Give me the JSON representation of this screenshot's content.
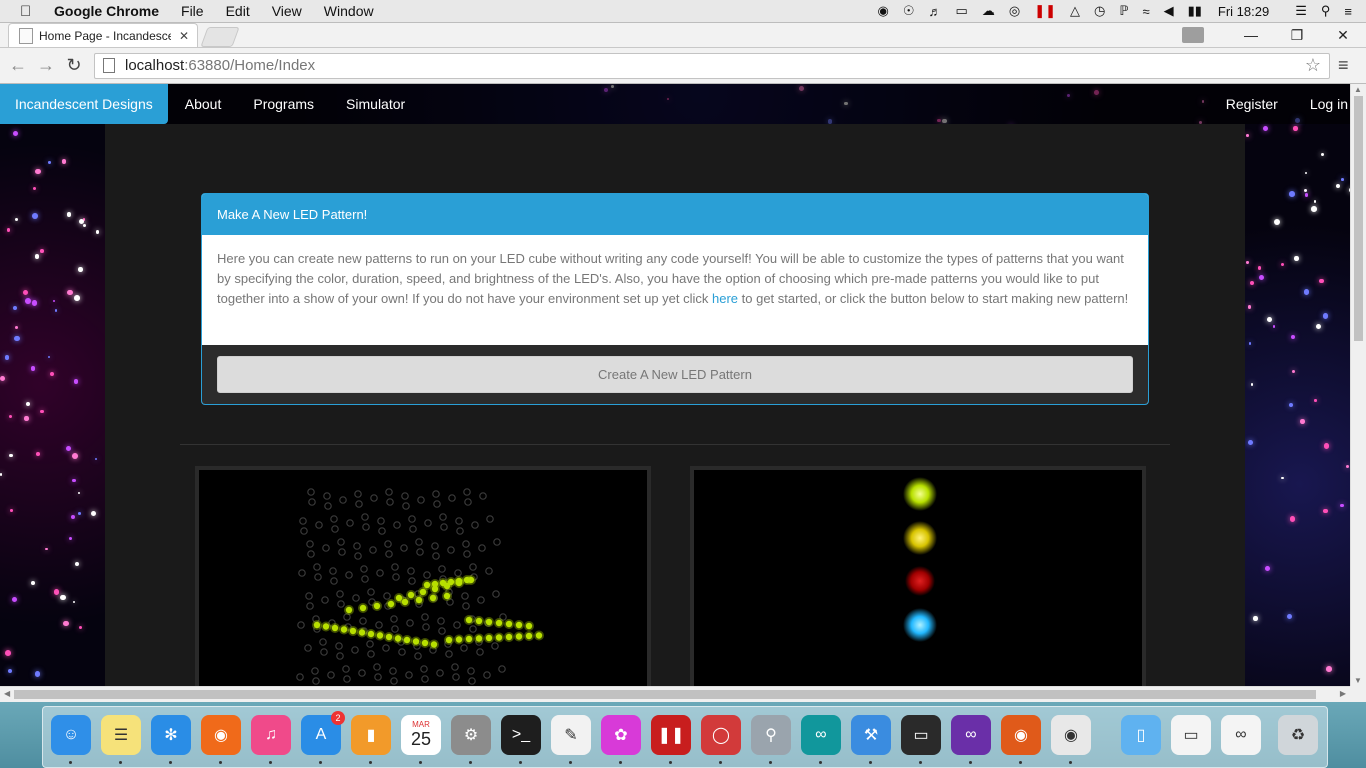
{
  "menubar": {
    "app": "Google Chrome",
    "items": [
      "File",
      "Edit",
      "View",
      "Window"
    ],
    "clock": "Fri 18:29"
  },
  "tab": {
    "title": "Home Page - Incandescen"
  },
  "address": {
    "host": "localhost",
    "path": ":63880/Home/Index"
  },
  "site": {
    "brand": "Incandescent Designs",
    "nav": [
      "About",
      "Programs",
      "Simulator"
    ],
    "nav_right": [
      "Register",
      "Log in"
    ]
  },
  "panel": {
    "heading": "Make A New LED Pattern!",
    "body_before": "Here you can create new patterns to run on your LED cube without writing any code yourself! You will be able to customize the types of patterns that you want by specifying the color, duration, speed, and brightness of the LED's. Also, you have the option of choosing which pre-made patterns you would like to put together into a show of your own! If you do not have your environment set up yet click ",
    "link": "here",
    "body_after": " to get started, or click the button below to start making new pattern!",
    "button": "Create A New LED Pattern"
  },
  "colors": {
    "accent": "#2a9fd6",
    "led_lime": "#b8e000",
    "led_yellow": "#d8c400",
    "led_red": "#c00000",
    "led_blue": "#22b8ff"
  },
  "dock": {
    "icons": [
      "finder-icon",
      "notes-icon",
      "safari-icon",
      "firefox-icon",
      "itunes-icon",
      "app-store-icon",
      "ibooks-icon",
      "calendar-icon",
      "system-preferences-icon",
      "terminal-icon",
      "textedit-icon",
      "flower-icon",
      "parallels-icon",
      "remote-desktop-icon",
      "keychain-icon",
      "arduino-icon",
      "xcode-icon",
      "display-icon",
      "visual-studio-icon",
      "firefox-dev-icon",
      "chrome-icon",
      "folder-icon",
      "screenshot-icon",
      "arduino-window-icon",
      "trash-icon"
    ],
    "app_store_badge": "2",
    "calendar_month": "MAR",
    "calendar_day": "25"
  }
}
